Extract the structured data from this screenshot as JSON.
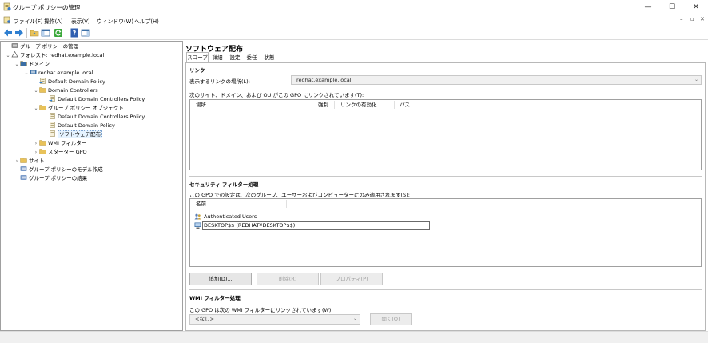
{
  "window": {
    "title": "グループ ポリシーの管理",
    "controls": {
      "minimize": "—",
      "maximize": "☐",
      "close": "✕"
    }
  },
  "menu": {
    "items": [
      "ファイル(F)",
      "操作(A)",
      "表示(V)",
      "ウィンドウ(W)",
      "ヘルプ(H)"
    ],
    "mdi": {
      "minimize": "–",
      "restore": "▫",
      "close": "✕"
    }
  },
  "tree": {
    "items": [
      {
        "label": "グループ ポリシーの管理",
        "icon": "gpm-root-icon",
        "twist": ""
      },
      {
        "label": "フォレスト: redhat.example.local",
        "icon": "forest-icon",
        "twist": "⌄"
      },
      {
        "label": "ドメイン",
        "icon": "domains-folder-icon",
        "twist": "⌄"
      },
      {
        "label": "redhat.example.local",
        "icon": "domain-icon",
        "twist": "⌄"
      },
      {
        "label": "Default Domain Policy",
        "icon": "gpo-link-icon",
        "twist": ""
      },
      {
        "label": "Domain Controllers",
        "icon": "ou-icon",
        "twist": "⌄"
      },
      {
        "label": "Default Domain Controllers Policy",
        "icon": "gpo-link-icon",
        "twist": ""
      },
      {
        "label": "グループ ポリシー オブジェクト",
        "icon": "gpo-container-icon",
        "twist": "⌄"
      },
      {
        "label": "Default Domain Controllers Policy",
        "icon": "gpo-icon",
        "twist": ""
      },
      {
        "label": "Default Domain Policy",
        "icon": "gpo-icon",
        "twist": ""
      },
      {
        "label": "ソフトウェア配布",
        "icon": "gpo-icon",
        "twist": ""
      },
      {
        "label": "WMI フィルター",
        "icon": "wmi-folder-icon",
        "twist": "›"
      },
      {
        "label": "スターター GPO",
        "icon": "starter-gpo-folder-icon",
        "twist": "›"
      },
      {
        "label": "サイト",
        "icon": "sites-icon",
        "twist": "›"
      },
      {
        "label": "グループ ポリシーのモデル作成",
        "icon": "modeling-icon",
        "twist": ""
      },
      {
        "label": "グループ ポリシーの結果",
        "icon": "results-icon",
        "twist": ""
      }
    ]
  },
  "detail": {
    "title": "ソフトウェア配布",
    "tabs": [
      "スコープ",
      "詳細",
      "設定",
      "委任",
      "状態"
    ],
    "links": {
      "heading": "リンク",
      "location_label": "表示するリンクの場所(L):",
      "location_value": "redhat.example.local",
      "description": "次のサイト、ドメイン、および OU がこの GPO にリンクされています(T):",
      "columns": [
        "場所",
        "強制",
        "リンクの有効化",
        "パス"
      ]
    },
    "security": {
      "heading": "セキュリティ フィルター処理",
      "description": "この GPO での設定は、次のグループ、ユーザーおよびコンピューターにのみ適用されます(S):",
      "column": "名前",
      "entries": [
        "Authenticated Users",
        "DESKTOP$$ (REDHAT¥DESKTOP$$)"
      ],
      "buttons": {
        "add": "追加(D)...",
        "remove": "削除(R)",
        "properties": "プロパティ(P)"
      }
    },
    "wmi": {
      "heading": "WMI フィルター処理",
      "description": "この GPO は次の WMI フィルターにリンクされています(W):",
      "value": "<なし>",
      "open": "開く(O)"
    }
  },
  "colors": {
    "selection": "#e5f3ff",
    "selection_border": "#7da2ce",
    "disabled_text": "#a0a0a0"
  }
}
